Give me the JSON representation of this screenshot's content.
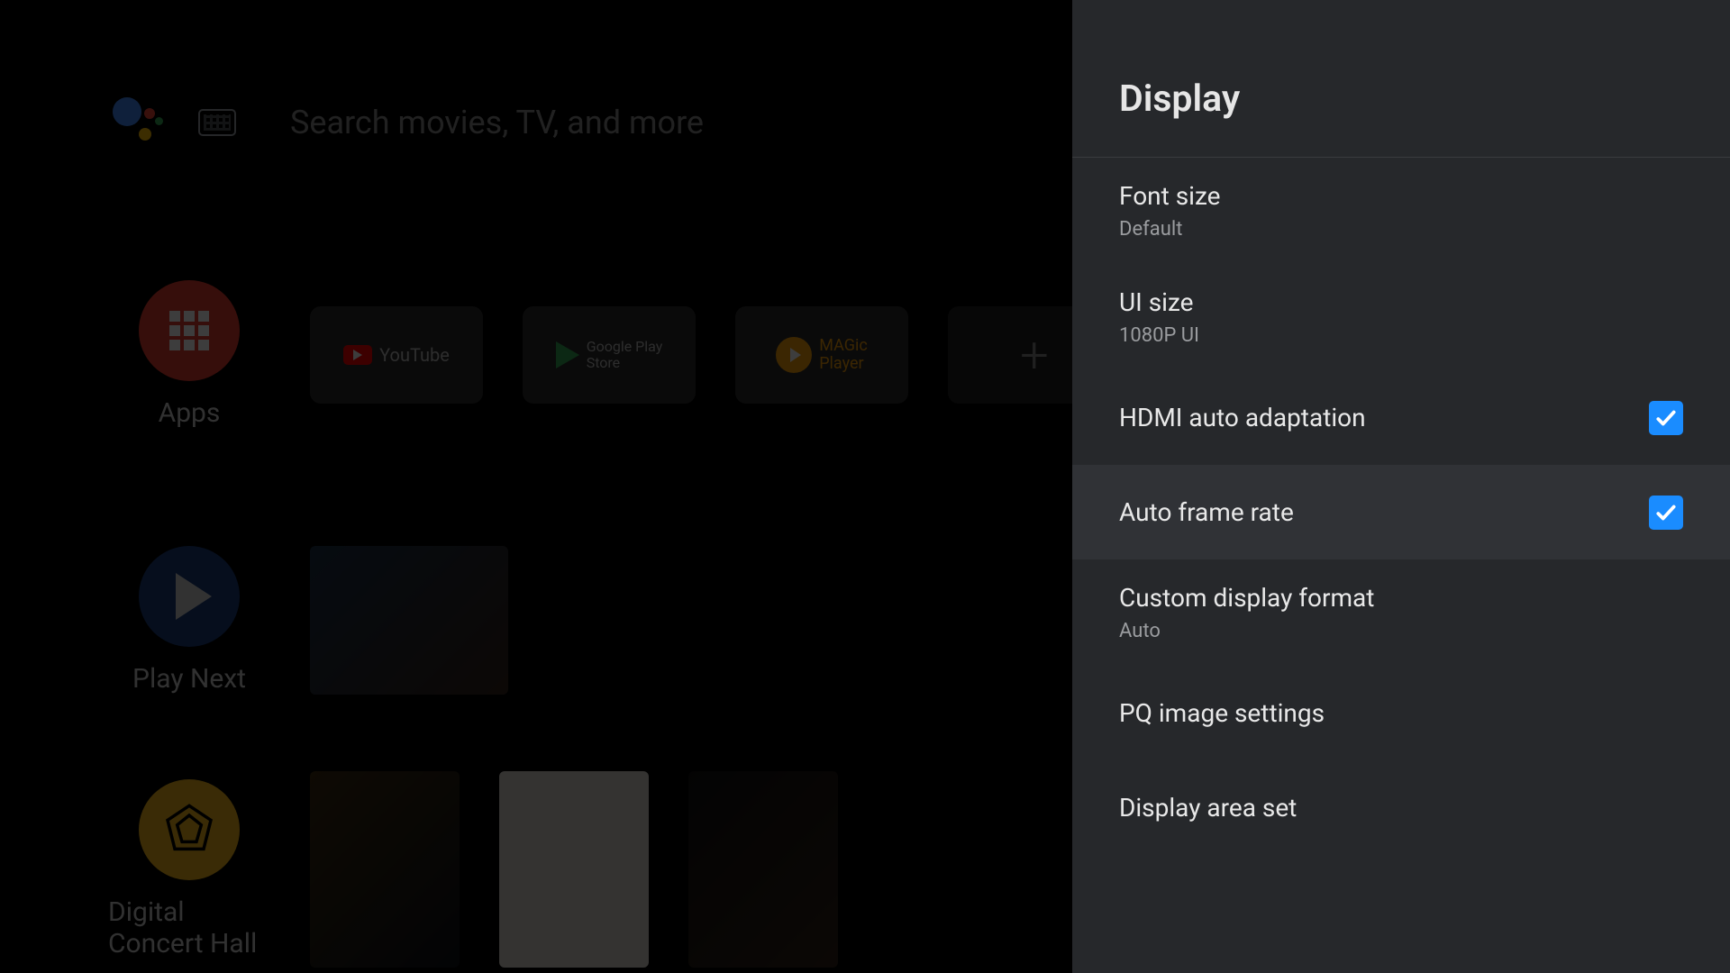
{
  "search": {
    "placeholder": "Search movies, TV, and more"
  },
  "rails": {
    "apps_label": "Apps",
    "playnext_label": "Play Next",
    "dch_label": "Digital Concert Hall",
    "apps": {
      "youtube_label": "YouTube",
      "gplay_label_l1": "Google Play",
      "gplay_label_l2": "Store",
      "magic_label_l1": "MAGic",
      "magic_label_l2": "Player"
    }
  },
  "settings": {
    "panel_title": "Display",
    "items": [
      {
        "title": "Font size",
        "sub": "Default"
      },
      {
        "title": "UI size",
        "sub": "1080P UI"
      },
      {
        "title": "HDMI auto adaptation",
        "checked": true
      },
      {
        "title": "Auto frame rate",
        "checked": true
      },
      {
        "title": "Custom display format",
        "sub": "Auto"
      },
      {
        "title": "PQ image settings"
      },
      {
        "title": "Display area set"
      }
    ],
    "focused_index": 3
  }
}
